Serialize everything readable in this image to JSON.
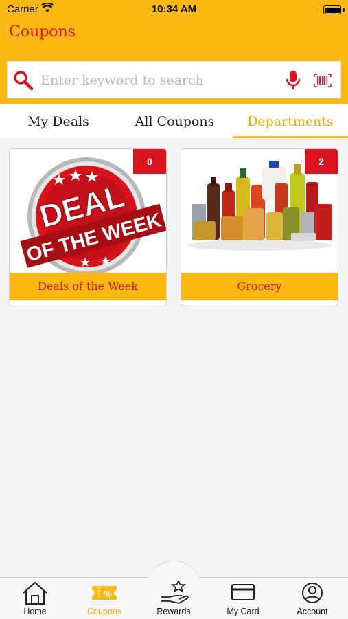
{
  "status": {
    "carrier": "Carrier",
    "time": "10:34 AM"
  },
  "header": {
    "title": "Coupons"
  },
  "search": {
    "placeholder": "Enter keyword to search"
  },
  "tabs": [
    {
      "label": "My Deals",
      "active": false
    },
    {
      "label": "All Coupons",
      "active": false
    },
    {
      "label": "Departments",
      "active": true
    }
  ],
  "departments": [
    {
      "name": "Deals of the Week",
      "count": "0",
      "image": "deal-of-the-week-image",
      "image_text": [
        "DEAL",
        "OF THE WEEK"
      ]
    },
    {
      "name": "Grocery",
      "count": "2",
      "image": "grocery-products-image"
    }
  ],
  "tabbar": [
    {
      "label": "Home",
      "icon": "home-icon"
    },
    {
      "label": "Coupons",
      "icon": "coupons-icon",
      "active": true
    },
    {
      "label": "Rewards",
      "icon": "rewards-icon"
    },
    {
      "label": "My Card",
      "icon": "card-icon"
    },
    {
      "label": "Account",
      "icon": "account-icon"
    }
  ],
  "colors": {
    "brand_yellow": "#fdb913",
    "brand_red": "#d9141e",
    "active_tab": "#f2a900"
  }
}
